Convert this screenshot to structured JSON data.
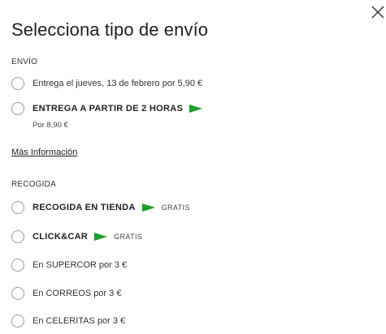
{
  "modal": {
    "title": "Selecciona tipo de envío",
    "close_icon": "close-icon"
  },
  "envio": {
    "label": "ENVÍO",
    "options": [
      {
        "text": "Entrega el jueves, 13 de febrero por 5,90 €"
      },
      {
        "text": "ENTREGA A PARTIR DE 2 HORAS",
        "sub": "Por 8,90 €",
        "flag": "green-flag-icon"
      }
    ],
    "more_info": "Más Información"
  },
  "recogida": {
    "label": "RECOGIDA",
    "options": [
      {
        "text": "RECOGIDA EN TIENDA",
        "flag": "green-flag-icon",
        "badge": "GRATIS"
      },
      {
        "text": "CLICK&CAR",
        "flag": "green-flag-icon",
        "badge": "GRATIS"
      },
      {
        "text": "En SUPERCOR por 3 €"
      },
      {
        "text": "En CORREOS por 3 €"
      },
      {
        "text": "En CELERITAS por 3 €"
      }
    ]
  },
  "colors": {
    "flag": "#1b9e2b",
    "radio_border": "#9a9a9a",
    "text": "#333333"
  }
}
